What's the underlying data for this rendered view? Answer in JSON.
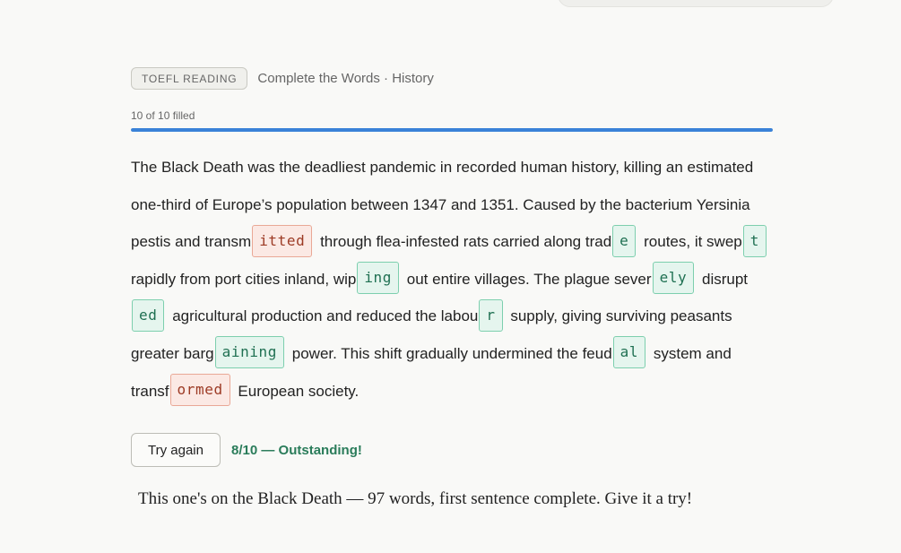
{
  "header": {
    "badge": "TOEFL READING",
    "subtitle": "Complete the Words · History"
  },
  "progress": {
    "label": "10 of 10 filled",
    "fraction": 1.0,
    "color": "#3a82d8"
  },
  "passage": {
    "t0": "The Black Death was the deadliest pandemic in recorded human history, killing an estimated one-third of Europe’s population between 1347 and 1351. Caused by the bacterium Yersinia pestis and transm",
    "b1": "itted",
    "t1": " through flea-infested rats carried along trad",
    "b2": "e",
    "t2": " routes, it swep",
    "b3": "t",
    "t3": " rapidly from port cities inland, wip",
    "b4": "ing",
    "t4": " out entire villages. The plague sever",
    "b5": "ely",
    "t5": " disrupt",
    "b6": "ed",
    "t6": " agricultural production and reduced the labou",
    "b7": "r",
    "t7": " supply, giving surviving peasants greater barg",
    "b8": "aining",
    "t8": " power. This shift gradually undermined the feud",
    "b9": "al",
    "t9": " system and transf",
    "b10": "ormed",
    "t10": " European society."
  },
  "actions": {
    "try_again": "Try again",
    "score": "8/10 — Outstanding!"
  },
  "footer": {
    "message": "This one's on the Black Death — 97 words, first sentence complete. Give it a try!"
  },
  "colors": {
    "correct_bg": "#e5f5ee",
    "correct_border": "#7dcfae",
    "incorrect_bg": "#fbe9e4",
    "incorrect_border": "#e9a896",
    "score_text": "#2a7c5a"
  }
}
